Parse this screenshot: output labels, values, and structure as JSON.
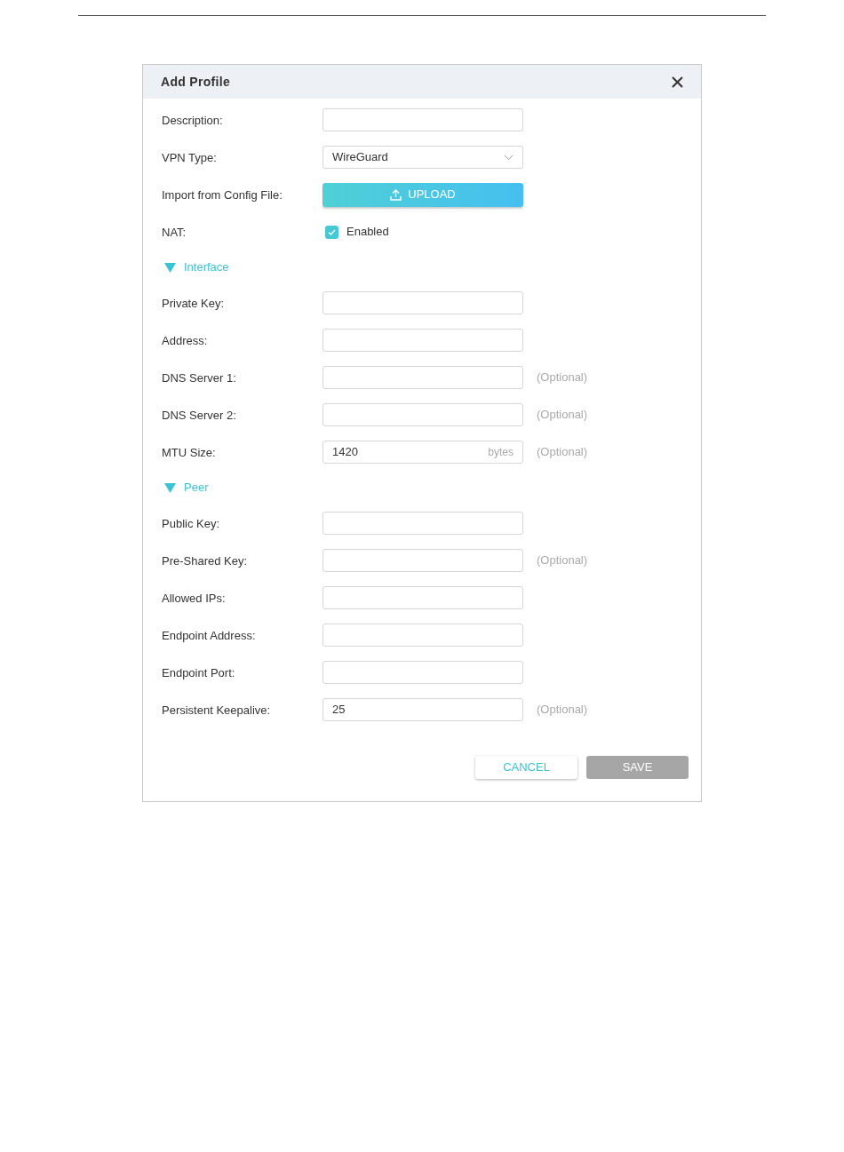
{
  "dialog": {
    "title": "Add Profile"
  },
  "rows": [
    {
      "kind": "field",
      "label": "Description:"
    },
    {
      "kind": "select",
      "label": "VPN Type:",
      "value": "WireGuard"
    },
    {
      "kind": "upload",
      "label": "Import from Config File:",
      "button_label": "UPLOAD"
    },
    {
      "kind": "checkbox",
      "label": "NAT:",
      "option": "Enabled",
      "checked": true
    },
    {
      "kind": "section",
      "label": "Interface",
      "expanded": true
    },
    {
      "kind": "field",
      "label": "Private Key:"
    },
    {
      "kind": "field",
      "label": "Address:"
    },
    {
      "kind": "field",
      "label": "DNS Server 1:",
      "hint": "(Optional)"
    },
    {
      "kind": "field",
      "label": "DNS Server 2:",
      "hint": "(Optional)"
    },
    {
      "kind": "field",
      "label": "MTU Size:",
      "value": "1420",
      "unit": "bytes",
      "hint": "(Optional)"
    },
    {
      "kind": "section",
      "label": "Peer",
      "expanded": true
    },
    {
      "kind": "field",
      "label": "Public Key:"
    },
    {
      "kind": "field",
      "label": "Pre-Shared Key:",
      "hint": "(Optional)"
    },
    {
      "kind": "field",
      "label": "Allowed IPs:"
    },
    {
      "kind": "field",
      "label": "Endpoint Address:"
    },
    {
      "kind": "field",
      "label": "Endpoint Port:"
    },
    {
      "kind": "field",
      "label": "Persistent Keepalive:",
      "value": "25",
      "hint": "(Optional)"
    }
  ],
  "buttons": [
    {
      "kind": "cancel",
      "label": "CANCEL",
      "disabled": false
    },
    {
      "kind": "save",
      "label": "SAVE",
      "disabled": true
    }
  ]
}
